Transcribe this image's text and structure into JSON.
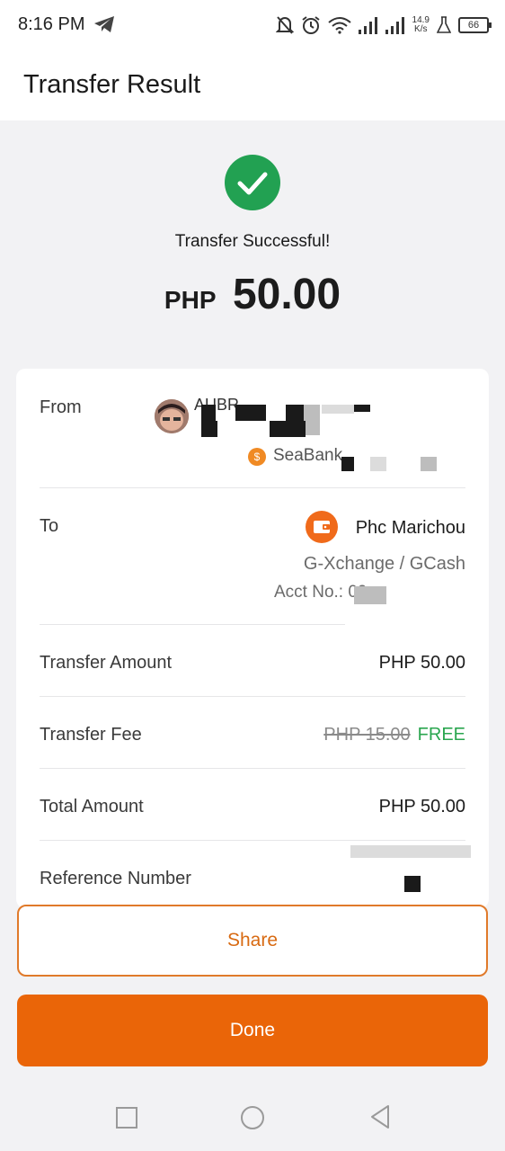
{
  "status_bar": {
    "time": "8:16 PM",
    "net_speed_value": "14.9",
    "net_speed_unit": "K/s",
    "battery": "66",
    "icons": [
      "telegram-icon",
      "bell-off-icon",
      "alarm-icon",
      "wifi-icon",
      "signal-icon",
      "signal-icon",
      "flask-icon",
      "battery-icon"
    ]
  },
  "header": {
    "title": "Transfer Result"
  },
  "result": {
    "message": "Transfer Successful!",
    "currency": "PHP",
    "amount": "50.00",
    "icon": "check-circle-icon",
    "accent_color": "#22a152"
  },
  "details": {
    "from": {
      "label": "From",
      "name_visible": "AUBR",
      "bank": "SeaBank",
      "bank_icon": "seabank-icon"
    },
    "to": {
      "label": "To",
      "name": "Phc Marichou",
      "provider": "G-Xchange / GCash",
      "acct_prefix": "Acct No.: 09",
      "icon": "wallet-icon"
    },
    "transfer_amount": {
      "label": "Transfer Amount",
      "value": "PHP 50.00"
    },
    "transfer_fee": {
      "label": "Transfer Fee",
      "original": "PHP 15.00",
      "value": "FREE"
    },
    "total_amount": {
      "label": "Total Amount",
      "value": "PHP 50.00"
    },
    "reference_number": {
      "label": "Reference Number"
    }
  },
  "buttons": {
    "share": "Share",
    "done": "Done",
    "primary_color": "#ea6508"
  },
  "nav": {
    "icons": [
      "recent-apps-icon",
      "home-icon",
      "back-icon"
    ]
  }
}
